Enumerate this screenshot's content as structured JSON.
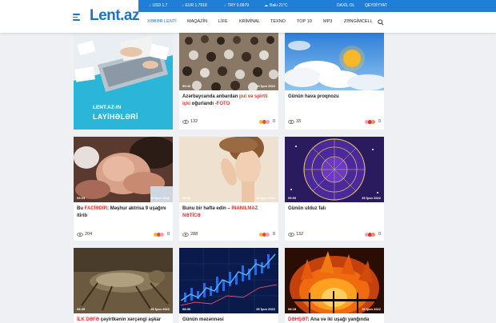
{
  "brand": {
    "logo": "Lent.az"
  },
  "topbar": {
    "usd": "USD 1.7",
    "eur": "EUR 1.7918",
    "try": "TRY 0.0979",
    "weather": "Bakı 21°C",
    "login": "DAXİL OL",
    "register": "QEYDİYYAT"
  },
  "nav": {
    "items": [
      "XƏBƏR LENTİ",
      "MAQAZİN",
      "LİFE",
      "KRİMİNAL",
      "TEXNO",
      "TOP 10",
      "MP3",
      "ZƏNGİMCELL"
    ],
    "active_index": 0
  },
  "cards": [
    {
      "promo_line1": "LENT.AZ-IN",
      "promo_line2": "LAYİHƏLƏRİ"
    },
    {
      "time": "09:42",
      "date": "25 İyun 2022",
      "title_a": "Azərbaycanda anbardan ",
      "title_red": "pul və spirtli içki",
      "title_b": " oğurlandı ",
      "title_red2": "-FOTO",
      "views": "132",
      "reactions": "0"
    },
    {
      "time": "",
      "date": "",
      "title_a": "Günün hava proqnozu",
      "views": "33",
      "reactions": "0"
    },
    {
      "time": "09:23",
      "date": "25 İyun 2022",
      "title_a": "Bu ",
      "title_red": "FACİƏDİR",
      "title_b": ": Məşhur aktrisa 9 uşağını itirib",
      "views": "204",
      "reactions": "0"
    },
    {
      "time": "09:08",
      "date": "25 İyun 2022",
      "title_a": "Bunu bir həftə edin – ",
      "title_red": "İNANILMAZ NƏTİCƏ",
      "views": "288",
      "reactions": "0"
    },
    {
      "time": "09:00",
      "date": "25 İyun 2022",
      "title_a": "Günün ulduz falı",
      "views": "132",
      "reactions": "0"
    },
    {
      "time": "08:49",
      "date": "25 İyun 2022",
      "title_red": "İLK DƏFƏ",
      "title_b": " çəyirtkənin xərçəngi aşkar"
    },
    {
      "time": "08:30",
      "date": "25 İyun 2022",
      "title_a": "Günün məzənnəsi"
    },
    {
      "time": "08:18",
      "date": "25 İyun 2022",
      "title_red": "DƏHŞƏT",
      "title_b": ": Ana və iki uşağı yanğında"
    }
  ],
  "colors": {
    "brand_blue": "#1a73c8",
    "topbar_blue": "#1f7fd6",
    "accent_red": "#e0322b"
  }
}
